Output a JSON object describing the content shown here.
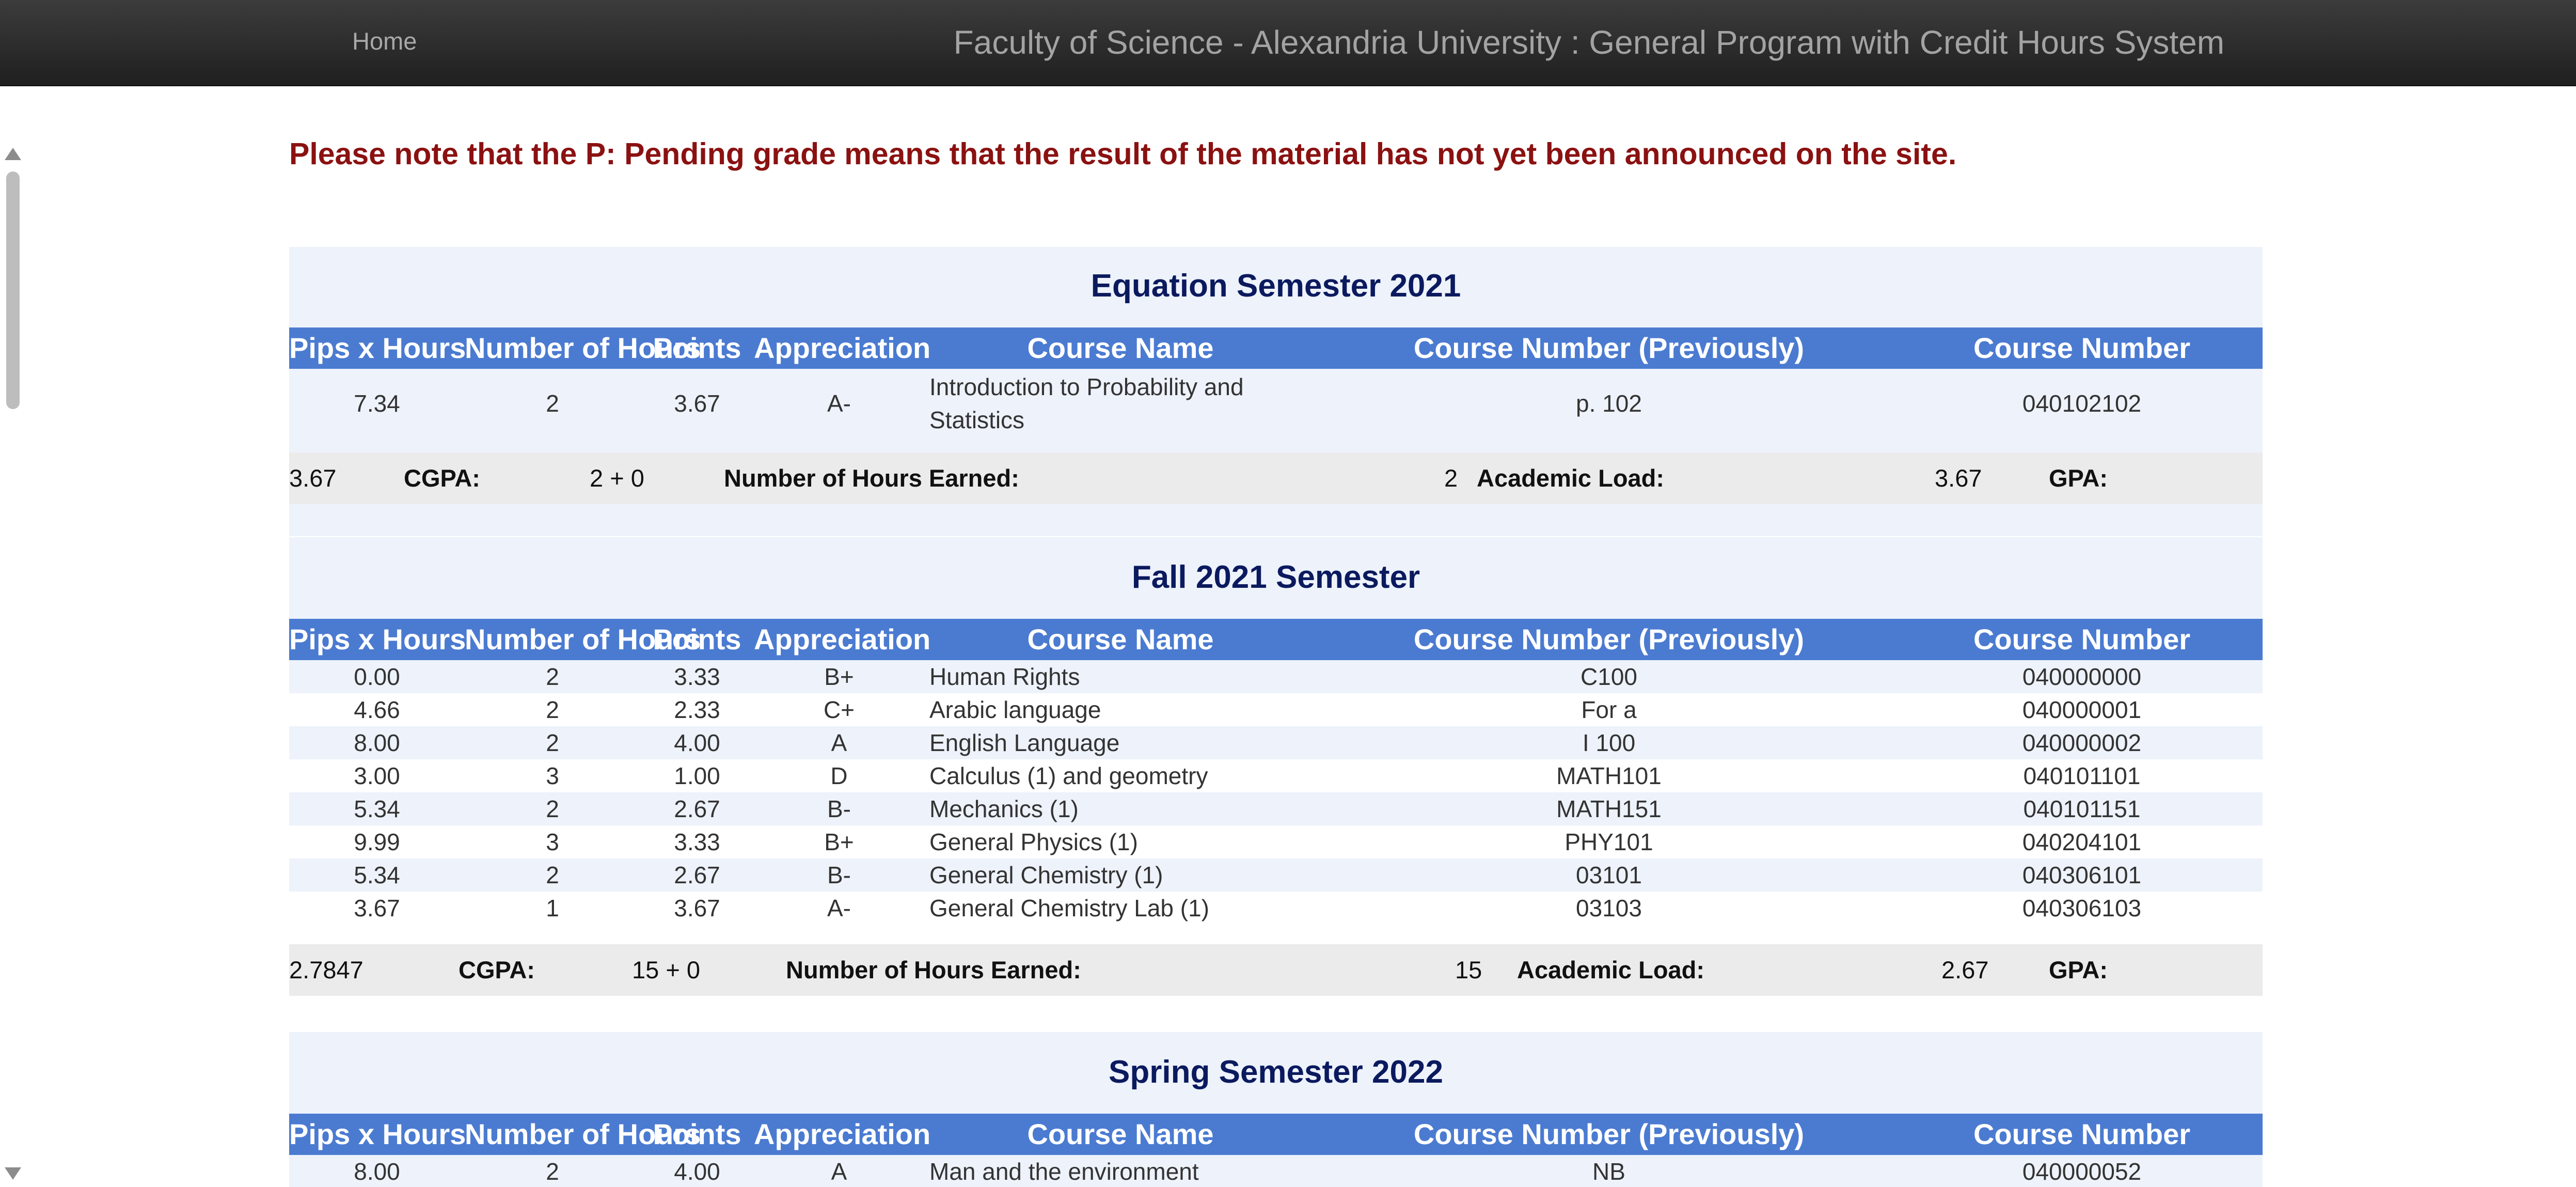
{
  "navbar": {
    "home_label": "Home",
    "title": "Faculty of Science - Alexandria University : General Program with Credit Hours System"
  },
  "notice": "Please note that the P: Pending grade means that the result of the material has not yet been announced on the site.",
  "columns": [
    "Pips x Hours",
    "Number of Hours",
    "Points",
    "Appreciation",
    "Course Name",
    "Course Number (Previously)",
    "Course Number"
  ],
  "semesters": [
    {
      "title": "Equation Semester 2021",
      "rows": [
        {
          "pips": "7.34",
          "hours": "2",
          "points": "3.67",
          "grade": "A-",
          "course_name": "Introduction to Probability and Statistics",
          "prev_number": "p. 102",
          "number": "040102102"
        }
      ],
      "summary": {
        "cgpa_value": "3.67",
        "cgpa_label": "CGPA:",
        "hours_earned_value": "2 + 0",
        "hours_earned_label": "Number of Hours Earned:",
        "load_value": "2",
        "load_label": "Academic Load:",
        "gpa_value": "3.67",
        "gpa_label": "GPA:"
      }
    },
    {
      "title": "Fall 2021 Semester",
      "rows": [
        {
          "pips": "0.00",
          "hours": "2",
          "points": "3.33",
          "grade": "B+",
          "course_name": "Human Rights",
          "prev_number": "C100",
          "number": "040000000"
        },
        {
          "pips": "4.66",
          "hours": "2",
          "points": "2.33",
          "grade": "C+",
          "course_name": "Arabic language",
          "prev_number": "For a",
          "number": "040000001"
        },
        {
          "pips": "8.00",
          "hours": "2",
          "points": "4.00",
          "grade": "A",
          "course_name": "English Language",
          "prev_number": "I 100",
          "number": "040000002"
        },
        {
          "pips": "3.00",
          "hours": "3",
          "points": "1.00",
          "grade": "D",
          "course_name": "Calculus (1) and geometry",
          "prev_number": "MATH101",
          "number": "040101101"
        },
        {
          "pips": "5.34",
          "hours": "2",
          "points": "2.67",
          "grade": "B-",
          "course_name": "Mechanics (1)",
          "prev_number": "MATH151",
          "number": "040101151"
        },
        {
          "pips": "9.99",
          "hours": "3",
          "points": "3.33",
          "grade": "B+",
          "course_name": "General Physics (1)",
          "prev_number": "PHY101",
          "number": "040204101"
        },
        {
          "pips": "5.34",
          "hours": "2",
          "points": "2.67",
          "grade": "B-",
          "course_name": "General Chemistry (1)",
          "prev_number": "03101",
          "number": "040306101"
        },
        {
          "pips": "3.67",
          "hours": "1",
          "points": "3.67",
          "grade": "A-",
          "course_name": "General Chemistry Lab (1)",
          "prev_number": "03103",
          "number": "040306103"
        }
      ],
      "summary": {
        "cgpa_value": "2.7847",
        "cgpa_label": "CGPA:",
        "hours_earned_value": "15 + 0",
        "hours_earned_label": "Number of Hours Earned:",
        "load_value": "15",
        "load_label": "Academic Load:",
        "gpa_value": "2.67",
        "gpa_label": "GPA:"
      }
    },
    {
      "title": "Spring Semester 2022",
      "rows": [
        {
          "pips": "8.00",
          "hours": "2",
          "points": "4.00",
          "grade": "A",
          "course_name": "Man and the environment",
          "prev_number": "NB",
          "number": "040000052"
        }
      ]
    }
  ]
}
